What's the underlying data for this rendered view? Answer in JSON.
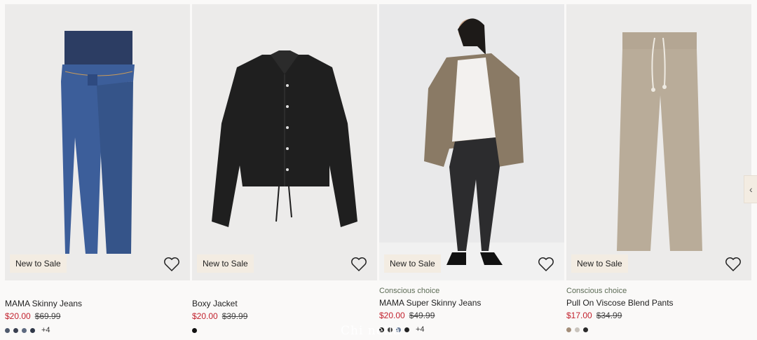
{
  "products": [
    {
      "name": "MAMA Skinny Jeans",
      "tag": "",
      "badge": "New to Sale",
      "price": "$20.00",
      "old_price": "$69.99",
      "swatches": [
        "#4f5a6d",
        "#3a4050",
        "#5e6a80",
        "#2f3848"
      ],
      "more_colors": "+4"
    },
    {
      "name": "Boxy Jacket",
      "tag": "",
      "badge": "New to Sale",
      "price": "$20.00",
      "old_price": "$39.99",
      "swatches": [
        "#111111"
      ],
      "more_colors": ""
    },
    {
      "name": "MAMA Super Skinny Jeans",
      "tag": "Conscious choice",
      "badge": "New to Sale",
      "price": "$20.00",
      "old_price": "$49.99",
      "swatches": [
        "#1b1b1b",
        "#3c3c3c",
        "#6d7f9a",
        "#222222"
      ],
      "more_colors": "+4"
    },
    {
      "name": "Pull On Viscose Blend Pants",
      "tag": "Conscious choice",
      "badge": "New to Sale",
      "price": "$17.00",
      "old_price": "$34.99",
      "swatches": [
        "#a38e7a",
        "#c9c4bd",
        "#2a2a2a"
      ],
      "more_colors": ""
    }
  ],
  "nav": {
    "next_icon": "chevron-icon"
  },
  "watermark": "Chi nella"
}
